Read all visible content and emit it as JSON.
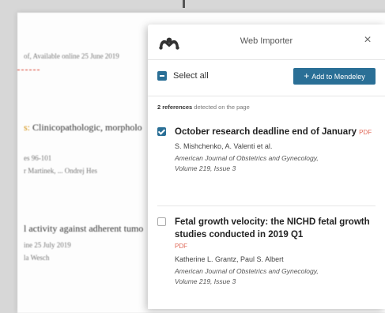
{
  "background": {
    "line1": "of, Available online 25 June 2019",
    "line2_accent": "s:",
    "line2_text": " Clinicopathologic, morpholo",
    "line3": "es 96-101",
    "line4": "r Martinek, ... Ondrej Hes",
    "line5": "l activity against adherent tumo",
    "line6": "ine 25 July 2019",
    "line7": "la Wesch"
  },
  "panel": {
    "title": "Web Importer",
    "close_symbol": "×",
    "select_all_label": "Select all",
    "add_button_plus": "+",
    "add_button_label": "Add to Mendeley",
    "ref_count_number": "2 references",
    "ref_count_text": " detected on the page"
  },
  "references": [
    {
      "checked": true,
      "title": "October research deadline end of January",
      "pdf": "PDF",
      "authors": "S. Mishchenko, A. Valenti et al.",
      "journal_line1": "American Journal of Obstetrics and Gynecology,",
      "journal_line2": "Volume 219, Issue 3"
    },
    {
      "checked": false,
      "title": "Fetal growth velocity: the NICHD fetal growth studies conducted in 2019 Q1",
      "pdf": "PDF",
      "authors": "Katherine L. Grantz, Paul S. Albert",
      "journal_line1": "American Journal of Obstetrics and Gynecology,",
      "journal_line2": "Volume 219, Issue 3"
    }
  ],
  "colors": {
    "accent": "#2a6f96",
    "pdf": "#e06a5a",
    "link_accent": "#d08a00",
    "dash": "#d9412f"
  },
  "icons": {
    "logo": "mendeley-logo-icon",
    "close": "close-icon",
    "select_all": "minus-checkbox-icon",
    "add": "plus-icon"
  }
}
